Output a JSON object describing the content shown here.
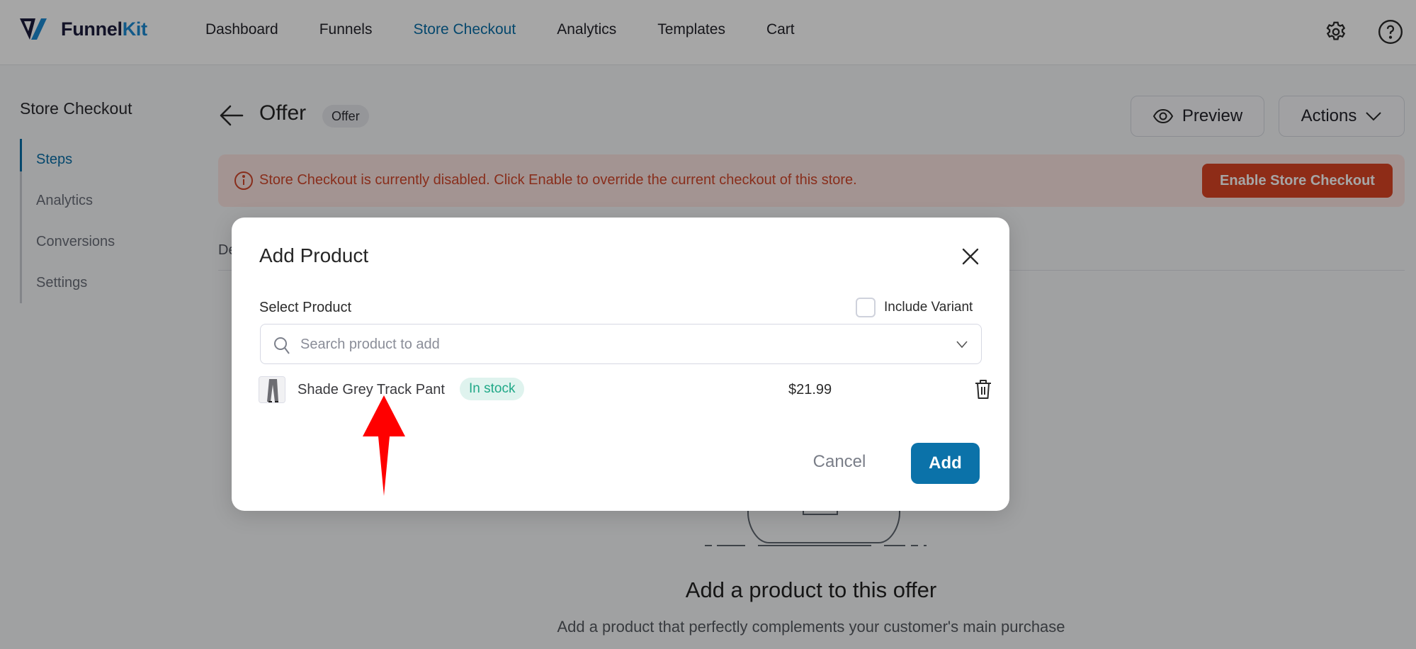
{
  "brand": {
    "name_part1": "Funnel",
    "name_part2": "Kit",
    "colors": {
      "dark": "#1c1d3d",
      "accent": "#1d8ad3"
    }
  },
  "nav": {
    "items": [
      {
        "label": "Dashboard",
        "active": false
      },
      {
        "label": "Funnels",
        "active": false
      },
      {
        "label": "Store Checkout",
        "active": true
      },
      {
        "label": "Analytics",
        "active": false
      },
      {
        "label": "Templates",
        "active": false
      },
      {
        "label": "Cart",
        "active": false
      }
    ],
    "icons": [
      "gear-icon",
      "help-icon"
    ]
  },
  "sidebar": {
    "title": "Store Checkout",
    "items": [
      {
        "label": "Steps",
        "active": true
      },
      {
        "label": "Analytics",
        "active": false
      },
      {
        "label": "Conversions",
        "active": false
      },
      {
        "label": "Settings",
        "active": false
      }
    ]
  },
  "header": {
    "title": "Offer",
    "badge": "Offer",
    "preview_label": "Preview",
    "actions_label": "Actions"
  },
  "alert": {
    "message": "Store Checkout is currently disabled. Click Enable to override the current checkout of this store.",
    "button_label": "Enable Store Checkout",
    "color": "#da4424"
  },
  "tabs": {
    "first_partial": "De"
  },
  "empty_state": {
    "title": "Add a product to this offer",
    "subtitle": "Add a product that perfectly complements your customer's main purchase"
  },
  "modal": {
    "title": "Add Product",
    "select_label": "Select Product",
    "include_variant_label": "Include Variant",
    "include_variant_checked": false,
    "search_placeholder": "Search product to add",
    "products": [
      {
        "name": "Shade Grey Track Pant",
        "stock": "In stock",
        "price": "$21.99"
      }
    ],
    "cancel_label": "Cancel",
    "add_label": "Add",
    "primary_color": "#0b72a9"
  },
  "annotation": {
    "type": "red-arrow-up",
    "color": "#ff0000"
  }
}
